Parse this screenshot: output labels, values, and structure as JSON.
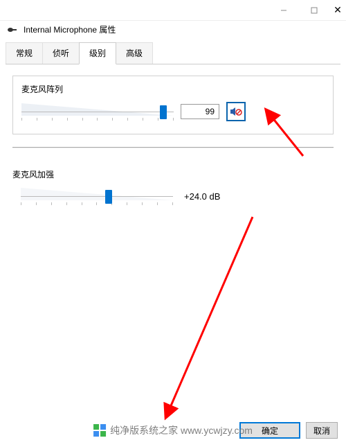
{
  "window": {
    "title": "Internal Microphone 属性"
  },
  "tabs": {
    "t0": "常规",
    "t1": "侦听",
    "t2": "级别",
    "t3": "高级"
  },
  "micArray": {
    "label": "麦克风阵列",
    "value": "99",
    "slider_percent": 95
  },
  "micBoost": {
    "label": "麦克风加强",
    "value": "+24.0 dB",
    "slider_percent": 58
  },
  "buttons": {
    "ok": "确定",
    "cancel": "取消"
  },
  "watermark": {
    "text": "纯净版系统之家 www.ycwjzy.com"
  }
}
